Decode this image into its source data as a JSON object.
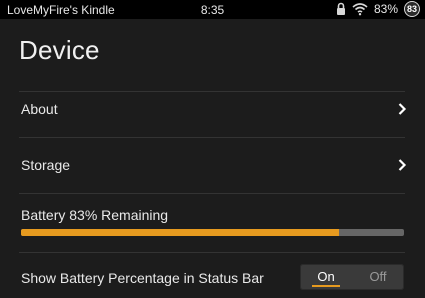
{
  "statusbar": {
    "device_name": "LoveMyFire's Kindle",
    "time": "8:35",
    "battery_text": "83%",
    "badge": "83"
  },
  "page": {
    "title": "Device"
  },
  "rows": {
    "about_label": "About",
    "storage_label": "Storage",
    "battery_label": "Battery 83% Remaining",
    "show_battery_label": "Show Battery Percentage in Status Bar"
  },
  "battery": {
    "level_percent": 83
  },
  "toggle": {
    "on_label": "On",
    "off_label": "Off",
    "selected": "On"
  },
  "colors": {
    "accent": "#e69a1f",
    "background": "#1c1c1c",
    "statusbar": "#000000"
  },
  "icons": {
    "lock": "lock-icon",
    "wifi": "wifi-icon",
    "chevron": "chevron-right-icon"
  }
}
